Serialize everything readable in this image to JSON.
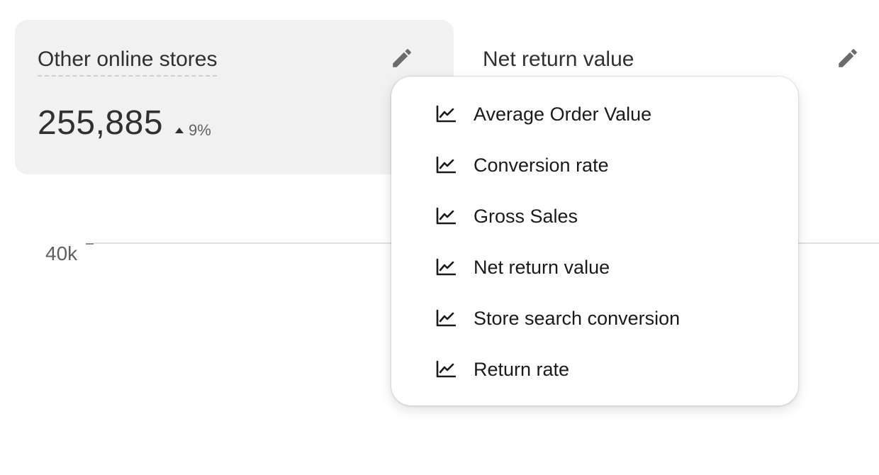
{
  "cards": [
    {
      "title": "Other online stores",
      "value": "255,885",
      "change": "9%",
      "trend_direction": "up",
      "icon": "pencil-icon"
    },
    {
      "title": "Net return value",
      "icon": "pencil-icon"
    }
  ],
  "chart": {
    "y_tick": "40k"
  },
  "menu": {
    "item_icon": "line-chart-icon",
    "items": [
      {
        "label": "Average Order Value"
      },
      {
        "label": "Conversion rate"
      },
      {
        "label": "Gross Sales"
      },
      {
        "label": "Net return value"
      },
      {
        "label": "Store search conversion"
      },
      {
        "label": "Return rate"
      }
    ]
  },
  "colors": {
    "selected_card_bg": "#f1f1f1",
    "text_primary": "#303030",
    "text_secondary": "#616161",
    "icon": "#6b6b6b"
  }
}
